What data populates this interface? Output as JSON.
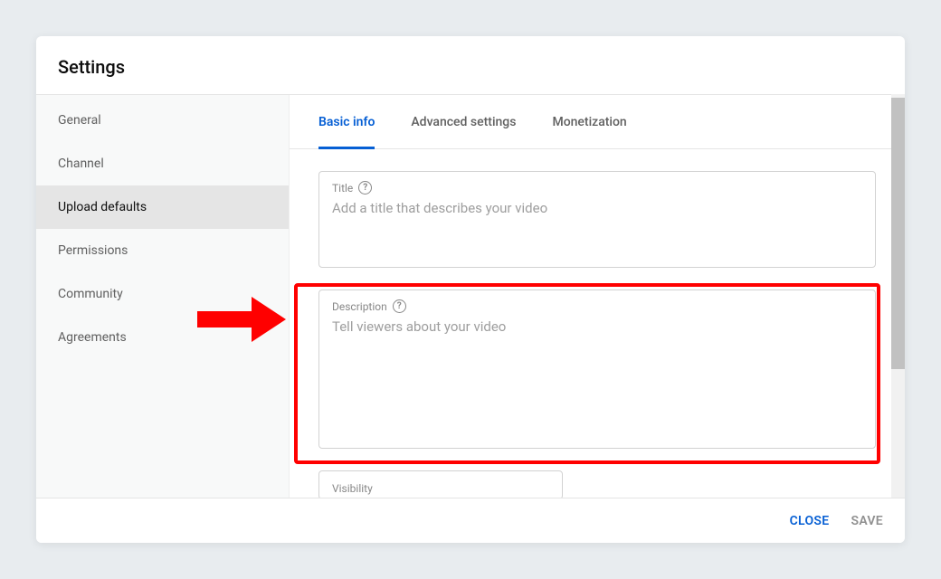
{
  "header": {
    "title": "Settings"
  },
  "sidebar": {
    "items": [
      {
        "label": "General",
        "active": false
      },
      {
        "label": "Channel",
        "active": false
      },
      {
        "label": "Upload defaults",
        "active": true
      },
      {
        "label": "Permissions",
        "active": false
      },
      {
        "label": "Community",
        "active": false
      },
      {
        "label": "Agreements",
        "active": false
      }
    ]
  },
  "tabs": [
    {
      "label": "Basic info",
      "active": true
    },
    {
      "label": "Advanced settings",
      "active": false
    },
    {
      "label": "Monetization",
      "active": false
    }
  ],
  "fields": {
    "title": {
      "label": "Title",
      "placeholder": "Add a title that describes your video",
      "value": ""
    },
    "description": {
      "label": "Description",
      "placeholder": "Tell viewers about your video",
      "value": ""
    },
    "visibility": {
      "label": "Visibility"
    }
  },
  "footer": {
    "close": "CLOSE",
    "save": "SAVE"
  },
  "annotation": {
    "highlight_target": "description-field",
    "arrow_color": "#ff0000"
  }
}
